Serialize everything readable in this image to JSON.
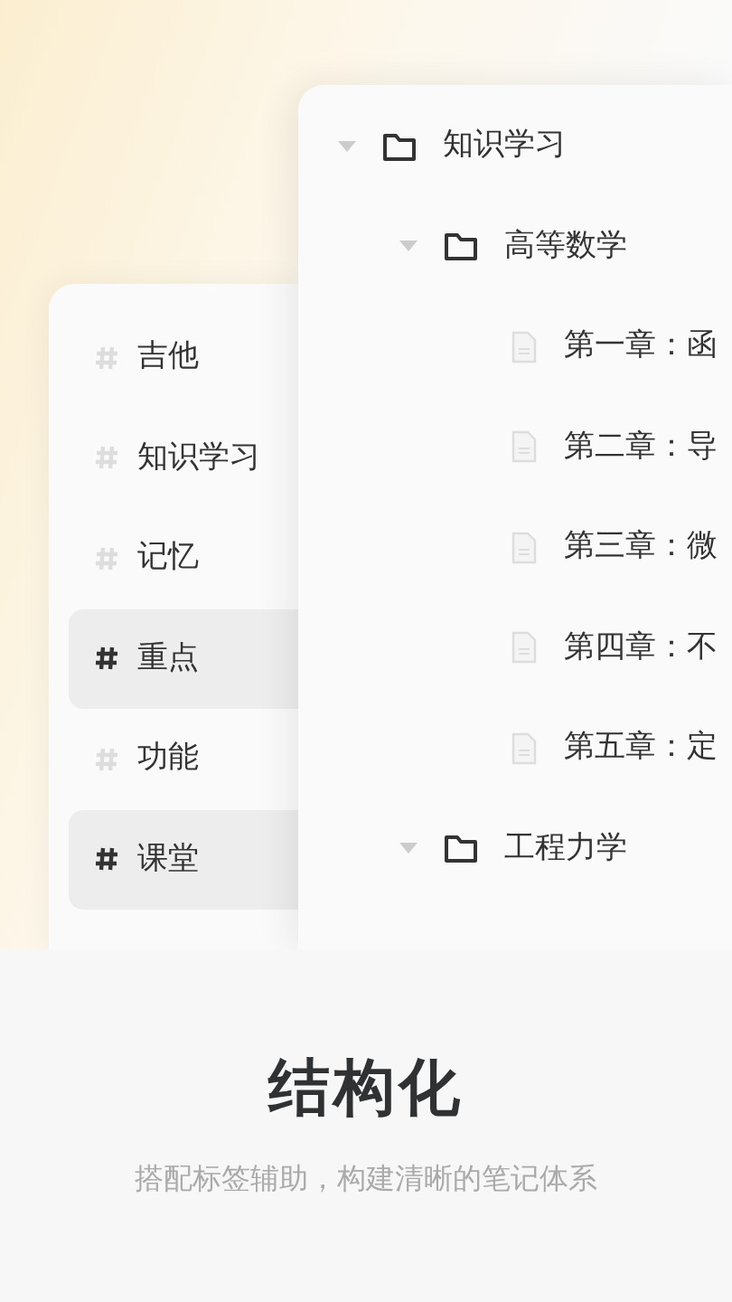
{
  "tags": [
    {
      "label": "吉他",
      "selected": false
    },
    {
      "label": "知识学习",
      "selected": false
    },
    {
      "label": "记忆",
      "selected": false
    },
    {
      "label": "重点",
      "selected": true
    },
    {
      "label": "功能",
      "selected": false
    },
    {
      "label": "课堂",
      "selected": true
    }
  ],
  "tree": [
    {
      "kind": "folder",
      "label": "知识学习",
      "expanded": true,
      "children": [
        {
          "kind": "folder",
          "label": "高等数学",
          "expanded": true,
          "children": [
            {
              "kind": "note",
              "label": "第一章：函"
            },
            {
              "kind": "note",
              "label": "第二章：导"
            },
            {
              "kind": "note",
              "label": "第三章：微"
            },
            {
              "kind": "note",
              "label": "第四章：不"
            },
            {
              "kind": "note",
              "label": "第五章：定"
            }
          ]
        },
        {
          "kind": "folder",
          "label": "工程力学",
          "expanded": true
        }
      ]
    }
  ],
  "headline": "结构化",
  "subtitle": "搭配标签辅助，构建清晰的笔记体系"
}
